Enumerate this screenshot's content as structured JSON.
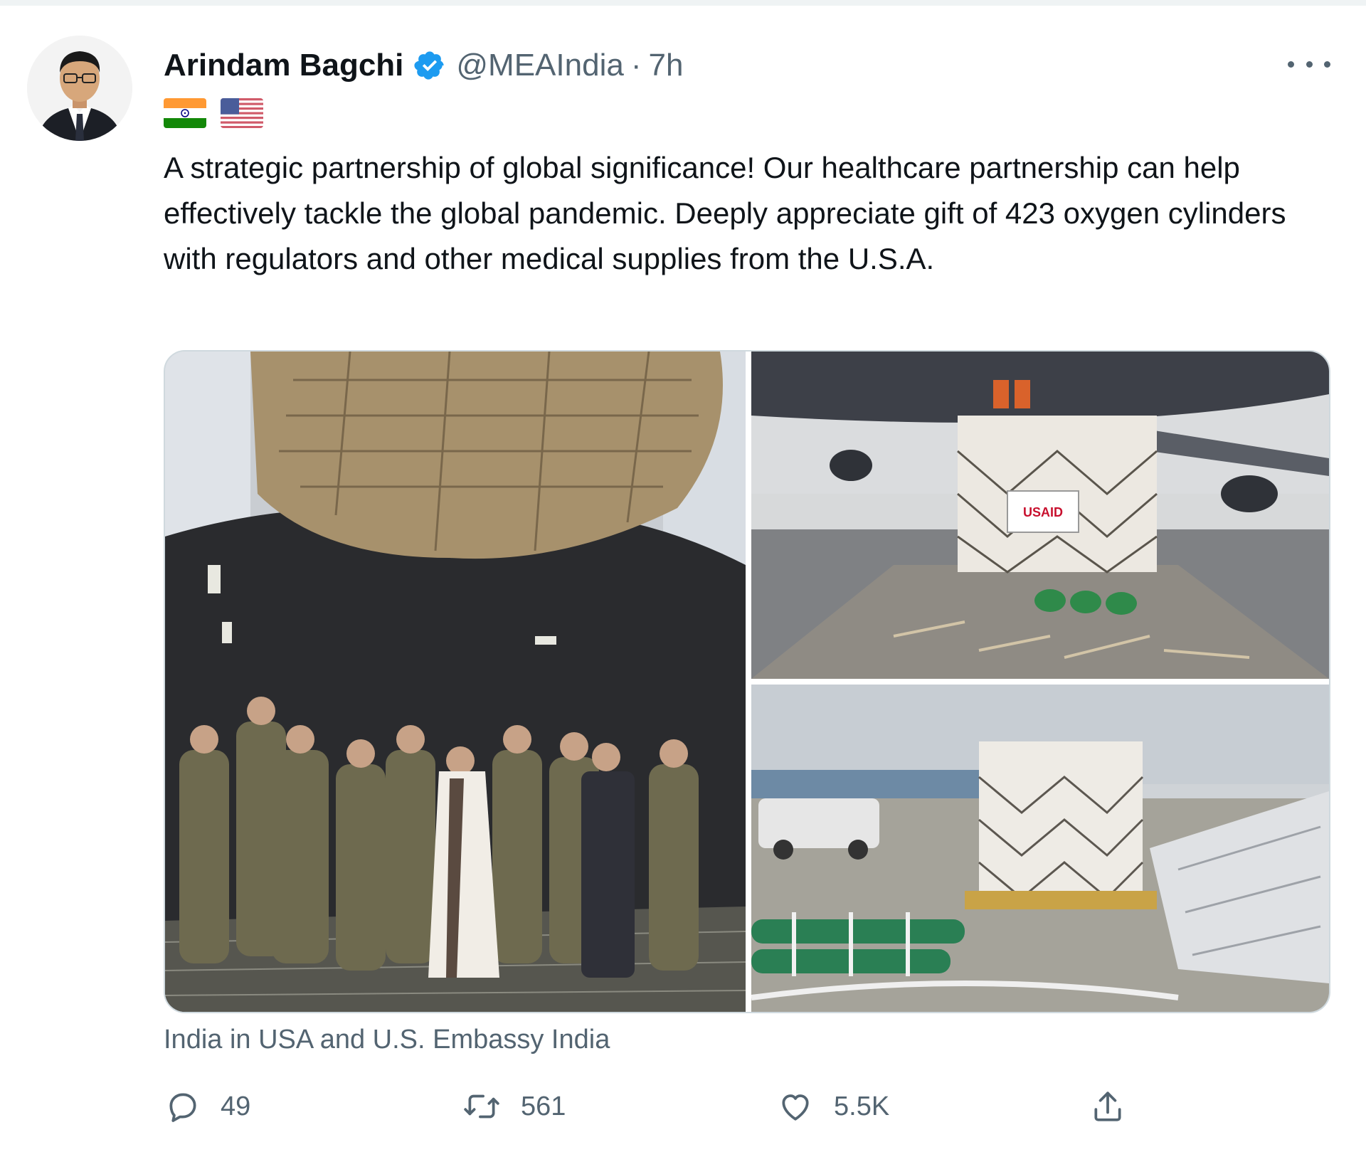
{
  "author": {
    "display_name": "Arindam Bagchi",
    "handle": "@MEAIndia",
    "separator": "·",
    "timestamp": "7h",
    "verified": true
  },
  "flags": [
    "india-flag",
    "usa-flag"
  ],
  "tweet": {
    "text": "A strategic partnership of global significance! Our healthcare partnership can help effectively tackle the global pandemic. Deeply appreciate gift of 423 oxygen cylinders with regulators and other medical supplies from the U.S.A."
  },
  "media": {
    "tagged_text": "India in USA and U.S. Embassy India",
    "cargo_label": "USAID"
  },
  "actions": {
    "reply_count": "49",
    "retweet_count": "561",
    "like_count": "5.5K"
  },
  "colors": {
    "accent": "#1d9bf0",
    "text_primary": "#0f1419",
    "text_secondary": "#536471",
    "border": "#cfd9de"
  },
  "icons": {
    "more": "more-icon",
    "reply": "reply-icon",
    "retweet": "retweet-icon",
    "like": "heart-icon",
    "share": "share-icon",
    "verified": "verified-badge-icon"
  }
}
